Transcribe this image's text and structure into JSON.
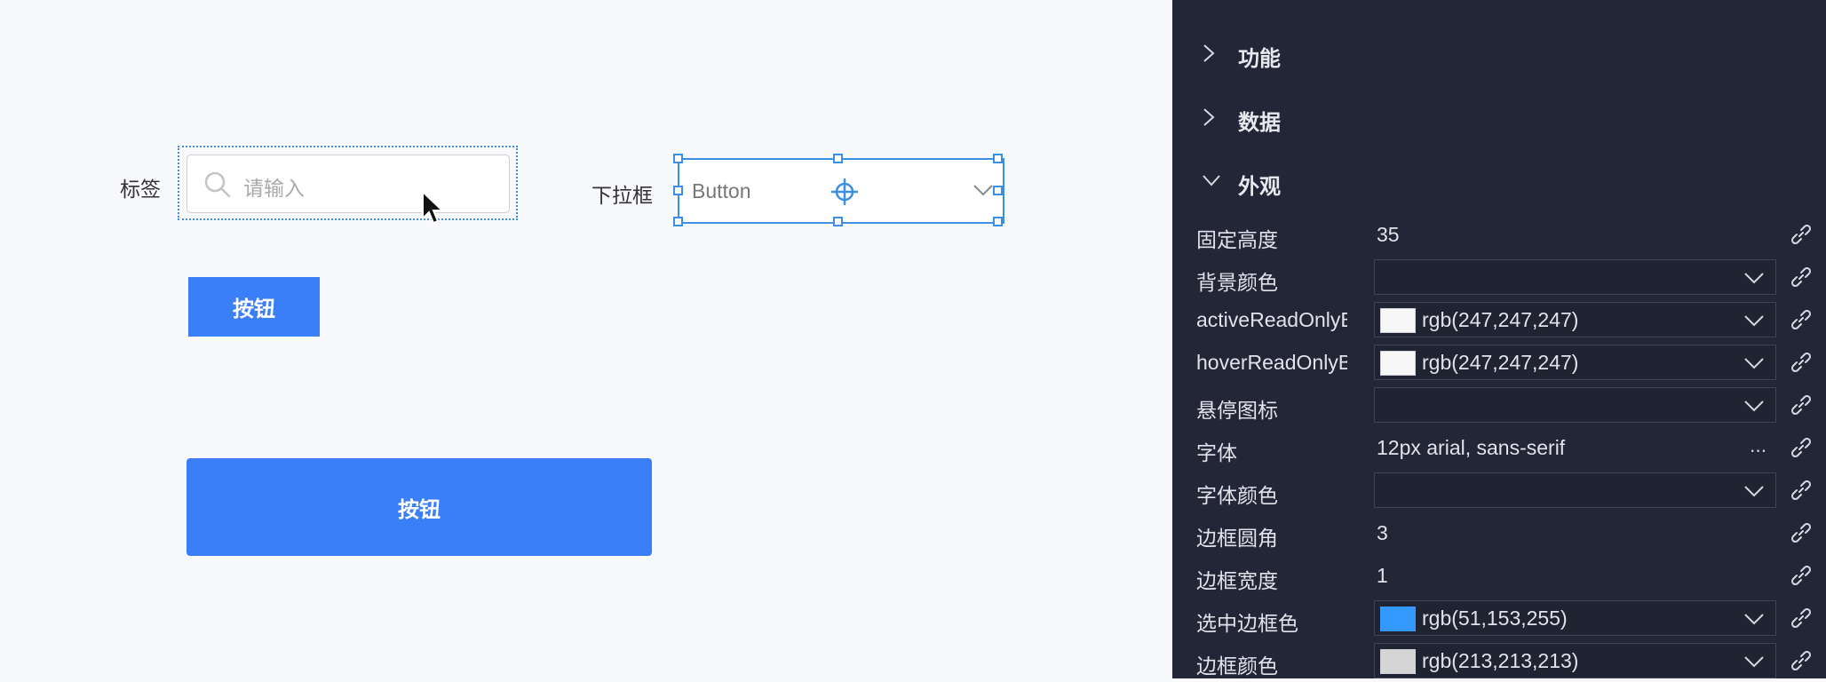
{
  "canvas": {
    "tag_label": "标签",
    "search_placeholder": "请输入",
    "dropdown_label": "下拉框",
    "dropdown_value": "Button",
    "button_small": "按钮",
    "button_large": "按钮"
  },
  "panel": {
    "sections": {
      "func": "功能",
      "data": "数据",
      "appearance": "外观"
    },
    "props": {
      "fixed_height": {
        "name": "固定高度",
        "value": "35"
      },
      "bg_color": {
        "name": "背景颜色"
      },
      "active_ro_bg": {
        "name": "activeReadOnlyBa",
        "value": "rgb(247,247,247)",
        "color": "#f7f7f7"
      },
      "hover_ro_bg": {
        "name": "hoverReadOnlyBa",
        "value": "rgb(247,247,247)",
        "color": "#f7f7f7"
      },
      "hover_icon": {
        "name": "悬停图标"
      },
      "font": {
        "name": "字体",
        "value": "12px arial, sans-serif",
        "more": "..."
      },
      "font_color": {
        "name": "字体颜色"
      },
      "border_radius": {
        "name": "边框圆角",
        "value": "3"
      },
      "border_width": {
        "name": "边框宽度",
        "value": "1"
      },
      "selected_border_color": {
        "name": "选中边框色",
        "value": "rgb(51,153,255)",
        "color": "#3399ff"
      },
      "border_color": {
        "name": "边框颜色",
        "value": "rgb(213,213,213)",
        "color": "#d5d5d5"
      }
    }
  }
}
